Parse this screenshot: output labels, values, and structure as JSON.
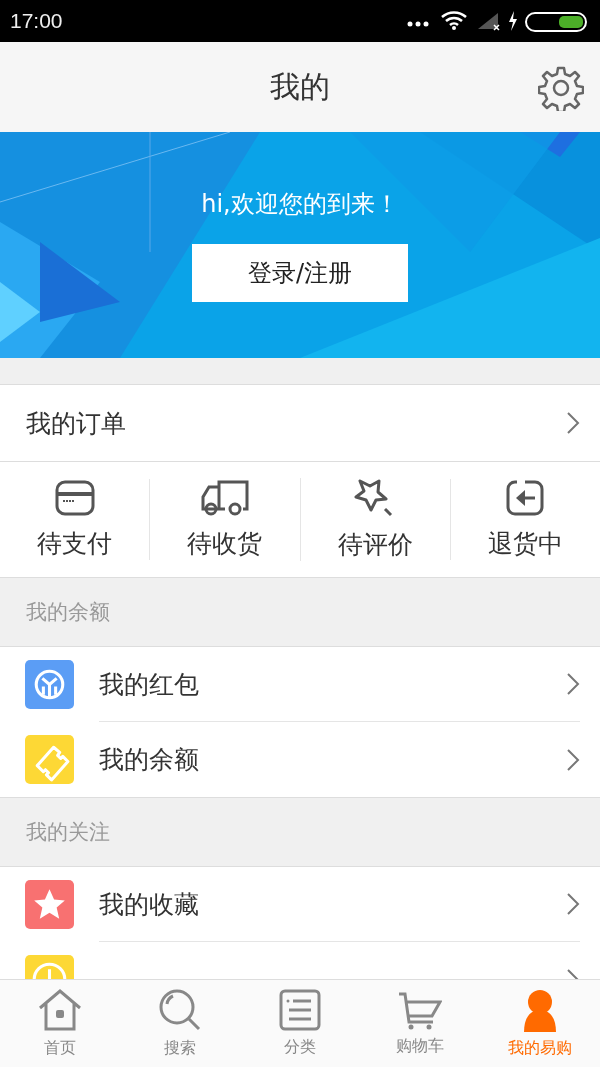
{
  "status_bar": {
    "time": "17:00"
  },
  "header": {
    "title": "我的"
  },
  "banner": {
    "greeting": "hi,欢迎您的到来！",
    "login_button": "登录/注册"
  },
  "orders": {
    "title": "我的订单",
    "shortcuts": [
      {
        "kind": "card",
        "label": "待支付"
      },
      {
        "kind": "truck",
        "label": "待收货"
      },
      {
        "kind": "star",
        "label": "待评价"
      },
      {
        "kind": "return",
        "label": "退货中"
      }
    ]
  },
  "sections": [
    {
      "title": "我的余额",
      "items": [
        {
          "kind": "coin",
          "color": "#5b9df5",
          "label": "我的红包"
        },
        {
          "kind": "ticket",
          "color": "#fdd835",
          "label": "我的余额"
        }
      ]
    },
    {
      "title": "我的关注",
      "items": [
        {
          "kind": "star",
          "color": "#f87171",
          "label": "我的收藏"
        },
        {
          "kind": "clock",
          "color": "#fdd835"
        }
      ]
    }
  ],
  "tab_bar": [
    {
      "kind": "home",
      "label": "首页",
      "selected": false
    },
    {
      "kind": "search",
      "label": "搜索",
      "selected": false
    },
    {
      "kind": "list",
      "label": "分类",
      "selected": false
    },
    {
      "kind": "cart",
      "label": "购物车",
      "selected": false
    },
    {
      "kind": "person",
      "label": "我的易购",
      "selected": true
    }
  ]
}
